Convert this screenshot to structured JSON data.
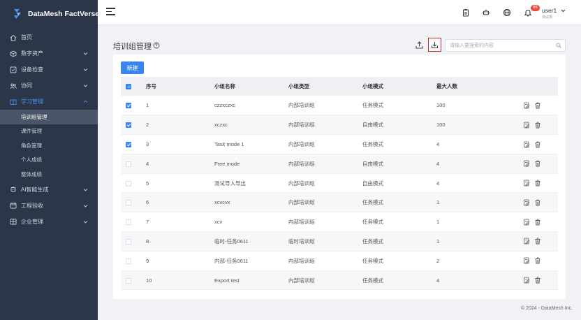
{
  "app": {
    "title": "DataMesh FactVerse"
  },
  "sidebar": {
    "items": [
      {
        "label": "首页",
        "icon": "home-icon",
        "has_children": false
      },
      {
        "label": "数字资产",
        "icon": "cube-icon",
        "has_children": true
      },
      {
        "label": "设备检查",
        "icon": "checklist-icon",
        "has_children": true
      },
      {
        "label": "协同",
        "icon": "people-icon",
        "has_children": true
      },
      {
        "label": "学习管理",
        "icon": "book-icon",
        "has_children": true,
        "active": true
      },
      {
        "label": "AI智能生成",
        "icon": "ai-icon",
        "has_children": true
      },
      {
        "label": "工程验收",
        "icon": "calendar-icon",
        "has_children": true
      },
      {
        "label": "企业管理",
        "icon": "enterprise-icon",
        "has_children": true
      }
    ],
    "sub_items": [
      {
        "label": "培训组管理",
        "selected": true
      },
      {
        "label": "课件管理"
      },
      {
        "label": "角色管理"
      },
      {
        "label": "个人成绩"
      },
      {
        "label": "整体成绩"
      }
    ]
  },
  "header": {
    "notification_count": "86",
    "user_name": "user1",
    "user_sub": "测试用"
  },
  "page": {
    "title": "培训组管理",
    "search_placeholder": "请输入要搜索的内容",
    "new_button": "新建"
  },
  "table": {
    "columns": [
      "序号",
      "小组名称",
      "小组类型",
      "小组模式",
      "最大人数"
    ],
    "rows": [
      {
        "checked": true,
        "seq": "1",
        "name": "czzxczxc",
        "type": "内部培训组",
        "mode": "任务模式",
        "max": "100"
      },
      {
        "checked": true,
        "seq": "2",
        "name": "xczxc",
        "type": "内部培训组",
        "mode": "自由模式",
        "max": "100"
      },
      {
        "checked": true,
        "seq": "3",
        "name": "Task mode 1",
        "type": "内部培训组",
        "mode": "任务模式",
        "max": "4"
      },
      {
        "checked": false,
        "seq": "4",
        "name": "Free mode",
        "type": "内部培训组",
        "mode": "自由模式",
        "max": "4"
      },
      {
        "checked": false,
        "seq": "5",
        "name": "测试导入导出",
        "type": "内部培训组",
        "mode": "自由模式",
        "max": "4"
      },
      {
        "checked": false,
        "seq": "6",
        "name": "xcvcvx",
        "type": "内部培训组",
        "mode": "任务模式",
        "max": "1"
      },
      {
        "checked": false,
        "seq": "7",
        "name": "xcv",
        "type": "内部培训组",
        "mode": "任务模式",
        "max": "1"
      },
      {
        "checked": false,
        "seq": "8",
        "name": "临时-任务0611",
        "type": "临时培训组",
        "mode": "任务模式",
        "max": "1"
      },
      {
        "checked": false,
        "seq": "9",
        "name": "内部-任务0611",
        "type": "内部培训组",
        "mode": "任务模式",
        "max": "2"
      },
      {
        "checked": false,
        "seq": "10",
        "name": "Export test",
        "type": "内部培训组",
        "mode": "任务模式",
        "max": "4"
      }
    ]
  },
  "footer": {
    "text": "© 2024 - DataMesh Inc."
  },
  "colors": {
    "sidebar_bg": "#2b3649",
    "accent": "#3a86f0",
    "highlight_border": "#e02020"
  }
}
